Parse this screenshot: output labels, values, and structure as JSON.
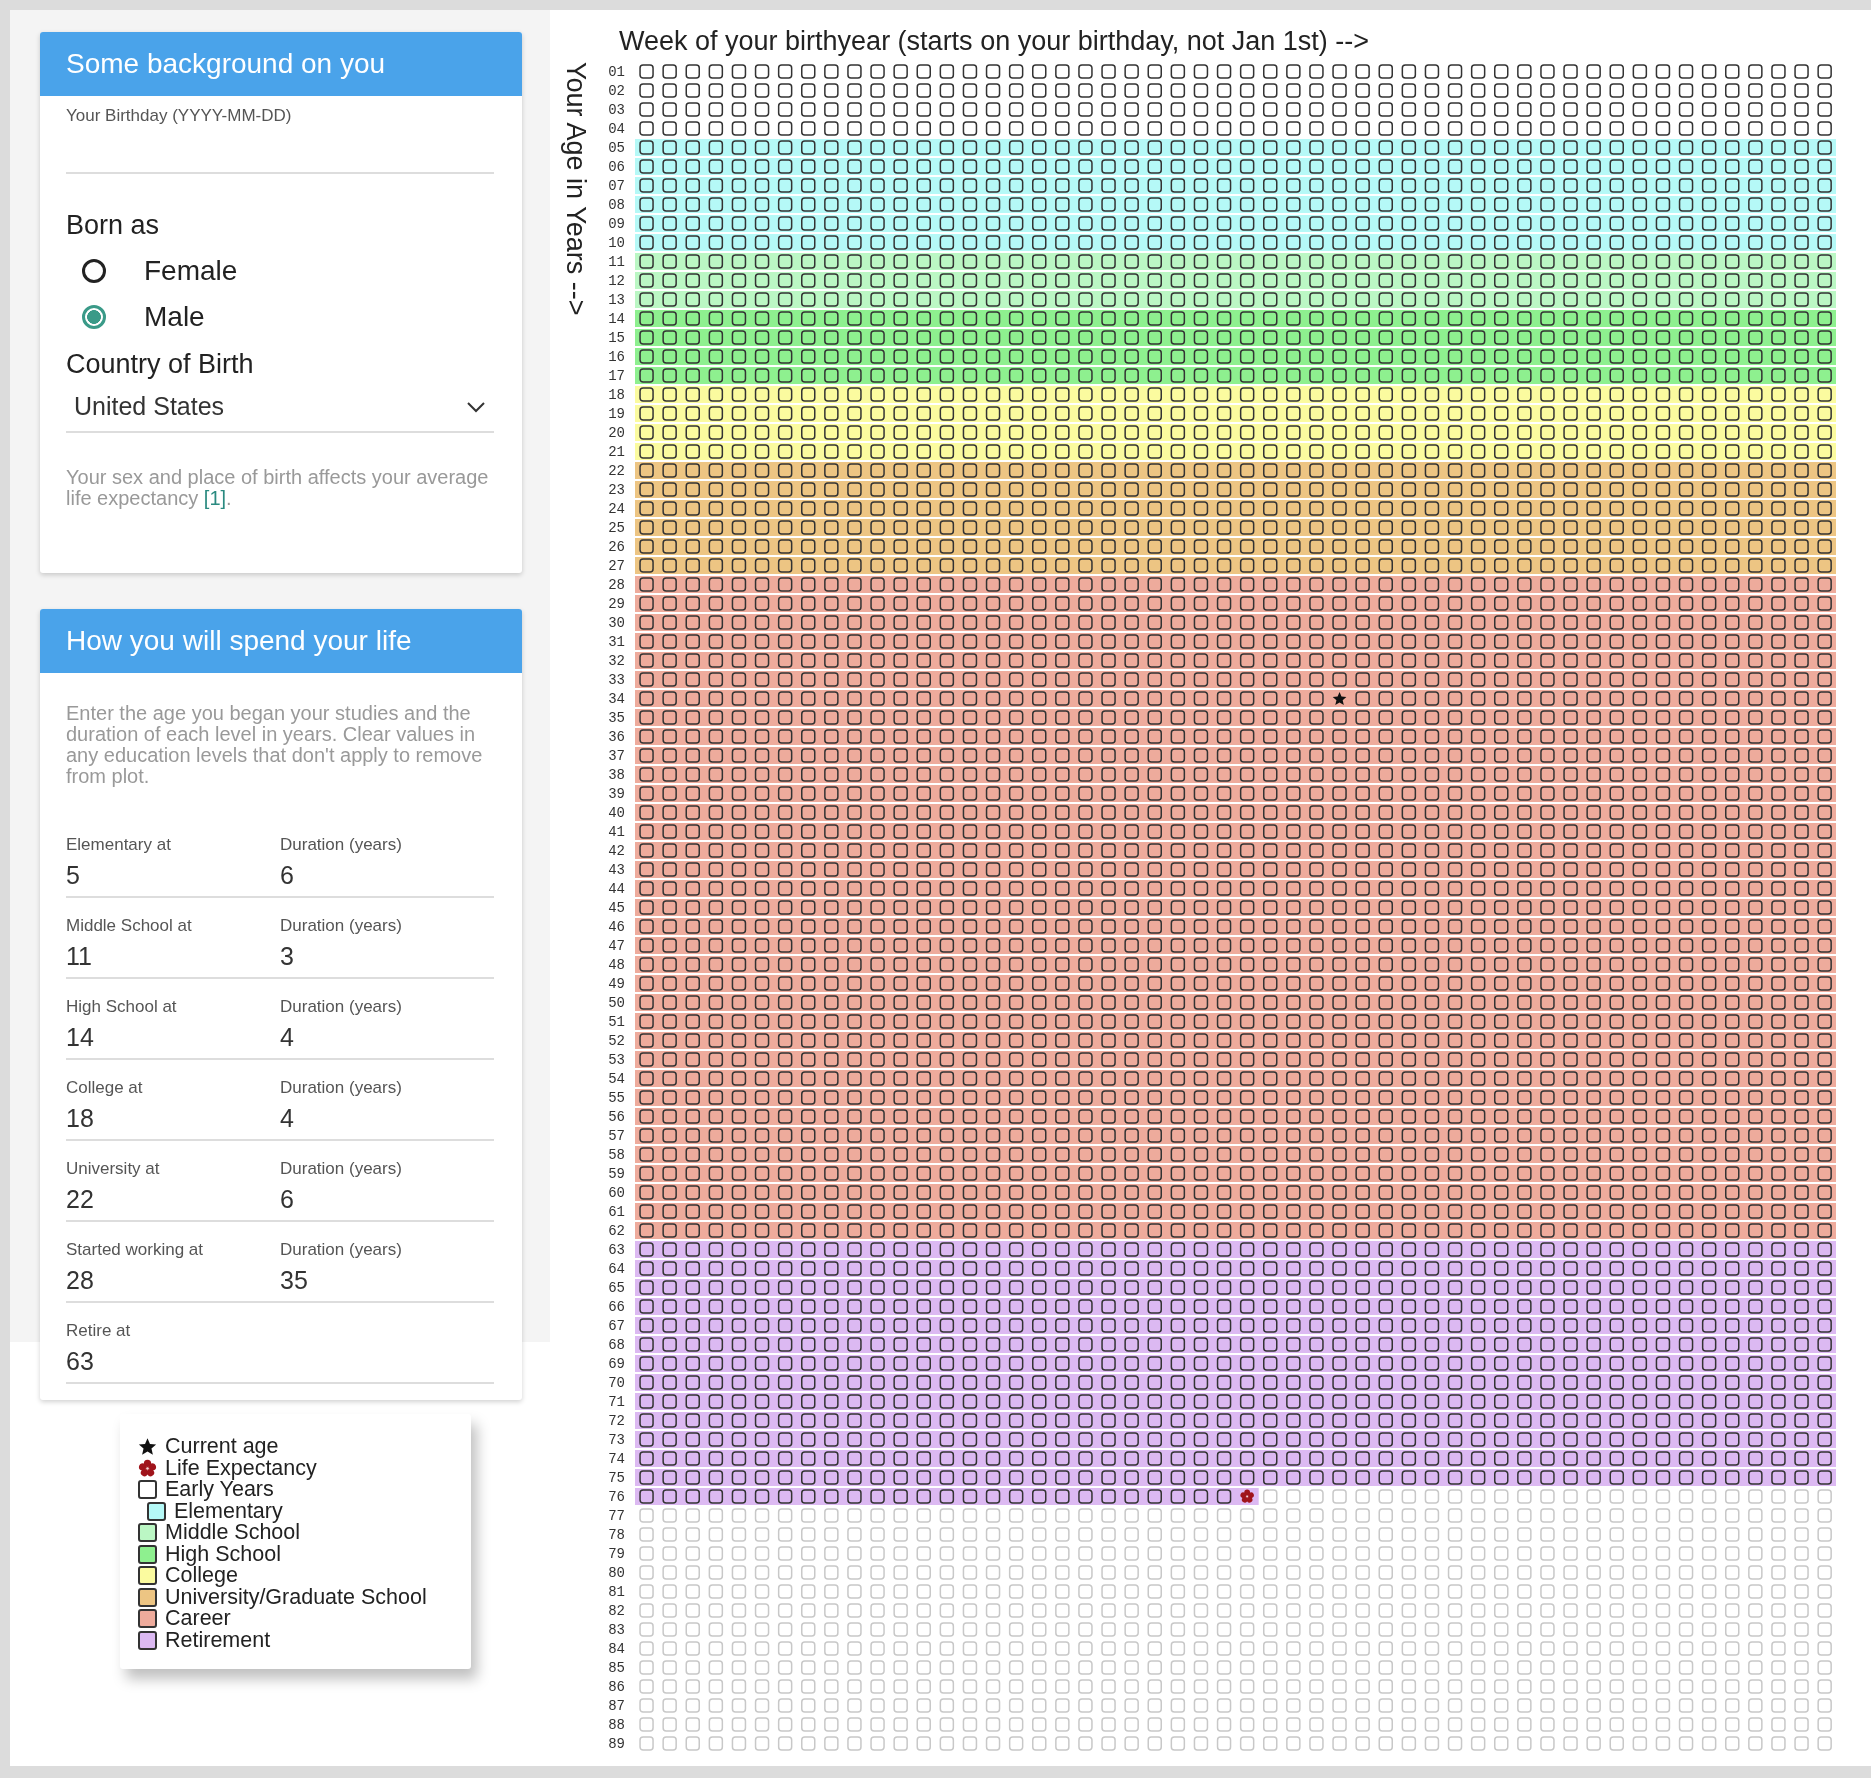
{
  "background_card": {
    "title": "Some background on you",
    "birthday": {
      "label": "Your Birthday (YYYY-MM-DD)"
    },
    "born_as": {
      "label": "Born as",
      "options": [
        {
          "label": "Female",
          "selected": false
        },
        {
          "label": "Male",
          "selected": true
        }
      ]
    },
    "country": {
      "label": "Country of Birth",
      "value": "United States"
    },
    "note": {
      "text": "Your sex and place of birth affects your average life expectancy",
      "link": "[1]",
      "end": "."
    }
  },
  "life_card": {
    "title": "How you will spend your life",
    "intro": "Enter the age you began your studies and the duration of each level in years. Clear values in any education levels that don't apply to remove from plot.",
    "fields": [
      {
        "label": "Elementary at",
        "value": "5",
        "duration_label": "Duration (years)",
        "duration": "6"
      },
      {
        "label": "Middle School at",
        "value": "11",
        "duration_label": "Duration (years)",
        "duration": "3"
      },
      {
        "label": "High School at",
        "value": "14",
        "duration_label": "Duration (years)",
        "duration": "4"
      },
      {
        "label": "College at",
        "value": "18",
        "duration_label": "Duration (years)",
        "duration": "4"
      },
      {
        "label": "University at",
        "value": "22",
        "duration_label": "Duration (years)",
        "duration": "6"
      },
      {
        "label": "Started working at",
        "value": "28",
        "duration_label": "Duration (years)",
        "duration": "35"
      },
      {
        "label": "Retire at",
        "value": "63"
      }
    ]
  },
  "legend": [
    {
      "label": "Current age",
      "kind": "star",
      "indented": false
    },
    {
      "label": "Life Expectancy",
      "kind": "flower",
      "indented": false
    },
    {
      "label": "Early Years",
      "kind": "swatch",
      "color": "#ffffff",
      "indented": false
    },
    {
      "label": "Elementary",
      "kind": "swatch",
      "color": "#b5f9f7",
      "indented": true
    },
    {
      "label": "Middle School",
      "kind": "swatch",
      "color": "#bbf7c4",
      "indented": false
    },
    {
      "label": "High School",
      "kind": "swatch",
      "color": "#8ef08f",
      "indented": false
    },
    {
      "label": "College",
      "kind": "swatch",
      "color": "#fbfb9f",
      "indented": false
    },
    {
      "label": "University/Graduate School",
      "kind": "swatch",
      "color": "#edc583",
      "indented": false
    },
    {
      "label": "Career",
      "kind": "swatch",
      "color": "#eeab9c",
      "indented": false
    },
    {
      "label": "Retirement",
      "kind": "swatch",
      "color": "#dcb9f2",
      "indented": false
    }
  ],
  "grid": {
    "title": "Week of your birthyear (starts on your birthday, not Jan 1st) -->",
    "axis_label": "Your Age in Years -->",
    "rows": [
      {
        "label": "01",
        "kind": "plain"
      },
      {
        "label": "02",
        "kind": "plain"
      },
      {
        "label": "03",
        "kind": "plain"
      },
      {
        "label": "04",
        "kind": "plain"
      },
      {
        "label": "05",
        "kind": "plain",
        "color": "#b5f9f7"
      },
      {
        "label": "06",
        "kind": "plain",
        "color": "#b5f9f7"
      },
      {
        "label": "07",
        "kind": "plain",
        "color": "#b5f9f7"
      },
      {
        "label": "08",
        "kind": "plain",
        "color": "#b5f9f7"
      },
      {
        "label": "09",
        "kind": "plain",
        "color": "#b5f9f7"
      },
      {
        "label": "10",
        "kind": "plain",
        "color": "#b5f9f7"
      },
      {
        "label": "11",
        "kind": "plain",
        "color": "#bbf7c4"
      },
      {
        "label": "12",
        "kind": "plain",
        "color": "#bbf7c4"
      },
      {
        "label": "13",
        "kind": "plain",
        "color": "#bbf7c4"
      },
      {
        "label": "14",
        "kind": "plain",
        "color": "#8ef08f"
      },
      {
        "label": "15",
        "kind": "plain",
        "color": "#8ef08f"
      },
      {
        "label": "16",
        "kind": "plain",
        "color": "#8ef08f"
      },
      {
        "label": "17",
        "kind": "plain",
        "color": "#8ef08f"
      },
      {
        "label": "18",
        "kind": "plain",
        "color": "#fbfb9f"
      },
      {
        "label": "19",
        "kind": "plain",
        "color": "#fbfb9f"
      },
      {
        "label": "20",
        "kind": "plain",
        "color": "#fbfb9f"
      },
      {
        "label": "21",
        "kind": "plain",
        "color": "#fbfb9f"
      },
      {
        "label": "22",
        "kind": "plain",
        "color": "#edc583"
      },
      {
        "label": "23",
        "kind": "plain",
        "color": "#edc583"
      },
      {
        "label": "24",
        "kind": "plain",
        "color": "#edc583"
      },
      {
        "label": "25",
        "kind": "plain",
        "color": "#edc583"
      },
      {
        "label": "26",
        "kind": "plain",
        "color": "#edc583"
      },
      {
        "label": "27",
        "kind": "plain",
        "color": "#edc583"
      },
      {
        "label": "28",
        "kind": "plain",
        "color": "#eeab9c"
      },
      {
        "label": "29",
        "kind": "plain",
        "color": "#eeab9c"
      },
      {
        "label": "30",
        "kind": "plain",
        "color": "#eeab9c"
      },
      {
        "label": "31",
        "kind": "plain",
        "color": "#eeab9c"
      },
      {
        "label": "32",
        "kind": "plain",
        "color": "#eeab9c"
      },
      {
        "label": "33",
        "kind": "plain",
        "color": "#eeab9c"
      },
      {
        "label": "34",
        "kind": "current",
        "color": "#eeab9c",
        "level": 0.596
      },
      {
        "label": "35",
        "kind": "plain",
        "color": "#eeab9c"
      },
      {
        "label": "36",
        "kind": "plain",
        "color": "#eeab9c"
      },
      {
        "label": "37",
        "kind": "plain",
        "color": "#eeab9c"
      },
      {
        "label": "38",
        "kind": "plain",
        "color": "#eeab9c"
      },
      {
        "label": "39",
        "kind": "plain",
        "color": "#eeab9c"
      },
      {
        "label": "40",
        "kind": "plain",
        "color": "#eeab9c"
      },
      {
        "label": "41",
        "kind": "plain",
        "color": "#eeab9c"
      },
      {
        "label": "42",
        "kind": "plain",
        "color": "#eeab9c"
      },
      {
        "label": "43",
        "kind": "plain",
        "color": "#eeab9c"
      },
      {
        "label": "44",
        "kind": "plain",
        "color": "#eeab9c"
      },
      {
        "label": "45",
        "kind": "plain",
        "color": "#eeab9c"
      },
      {
        "label": "46",
        "kind": "plain",
        "color": "#eeab9c"
      },
      {
        "label": "47",
        "kind": "plain",
        "color": "#eeab9c"
      },
      {
        "label": "48",
        "kind": "plain",
        "color": "#eeab9c"
      },
      {
        "label": "49",
        "kind": "plain",
        "color": "#eeab9c"
      },
      {
        "label": "50",
        "kind": "plain",
        "color": "#eeab9c"
      },
      {
        "label": "51",
        "kind": "plain",
        "color": "#eeab9c"
      },
      {
        "label": "52",
        "kind": "plain",
        "color": "#eeab9c"
      },
      {
        "label": "53",
        "kind": "plain",
        "color": "#eeab9c"
      },
      {
        "label": "54",
        "kind": "plain",
        "color": "#eeab9c"
      },
      {
        "label": "55",
        "kind": "plain",
        "color": "#eeab9c"
      },
      {
        "label": "56",
        "kind": "plain",
        "color": "#eeab9c"
      },
      {
        "label": "57",
        "kind": "plain",
        "color": "#eeab9c"
      },
      {
        "label": "58",
        "kind": "plain",
        "color": "#eeab9c"
      },
      {
        "label": "59",
        "kind": "plain",
        "color": "#eeab9c"
      },
      {
        "label": "60",
        "kind": "plain",
        "color": "#eeab9c"
      },
      {
        "label": "61",
        "kind": "plain",
        "color": "#eeab9c"
      },
      {
        "label": "62",
        "kind": "plain",
        "color": "#eeab9c"
      },
      {
        "label": "63",
        "kind": "plain",
        "color": "#dcb9f2"
      },
      {
        "label": "64",
        "kind": "plain",
        "color": "#dcb9f2"
      },
      {
        "label": "65",
        "kind": "plain",
        "color": "#dcb9f2"
      },
      {
        "label": "66",
        "kind": "plain",
        "color": "#dcb9f2"
      },
      {
        "label": "67",
        "kind": "plain",
        "color": "#dcb9f2"
      },
      {
        "label": "68",
        "kind": "plain",
        "color": "#dcb9f2"
      },
      {
        "label": "69",
        "kind": "plain",
        "color": "#dcb9f2"
      },
      {
        "label": "70",
        "kind": "plain",
        "color": "#dcb9f2"
      },
      {
        "label": "71",
        "kind": "plain",
        "color": "#dcb9f2"
      },
      {
        "label": "72",
        "kind": "plain",
        "color": "#dcb9f2"
      },
      {
        "label": "73",
        "kind": "plain",
        "color": "#dcb9f2"
      },
      {
        "label": "74",
        "kind": "plain",
        "color": "#dcb9f2"
      },
      {
        "label": "75",
        "kind": "plain",
        "color": "#dcb9f2"
      },
      {
        "label": "76",
        "kind": "expectancy",
        "color": "#dcb9f2",
        "level": 0.519
      },
      {
        "label": "77",
        "kind": "future"
      },
      {
        "label": "78",
        "kind": "future"
      },
      {
        "label": "79",
        "kind": "future"
      },
      {
        "label": "80",
        "kind": "future"
      },
      {
        "label": "81",
        "kind": "future"
      },
      {
        "label": "82",
        "kind": "future"
      },
      {
        "label": "83",
        "kind": "future"
      },
      {
        "label": "84",
        "kind": "future"
      },
      {
        "label": "85",
        "kind": "future"
      },
      {
        "label": "86",
        "kind": "future"
      },
      {
        "label": "87",
        "kind": "future"
      },
      {
        "label": "88",
        "kind": "future"
      },
      {
        "label": "89",
        "kind": "future"
      }
    ]
  }
}
